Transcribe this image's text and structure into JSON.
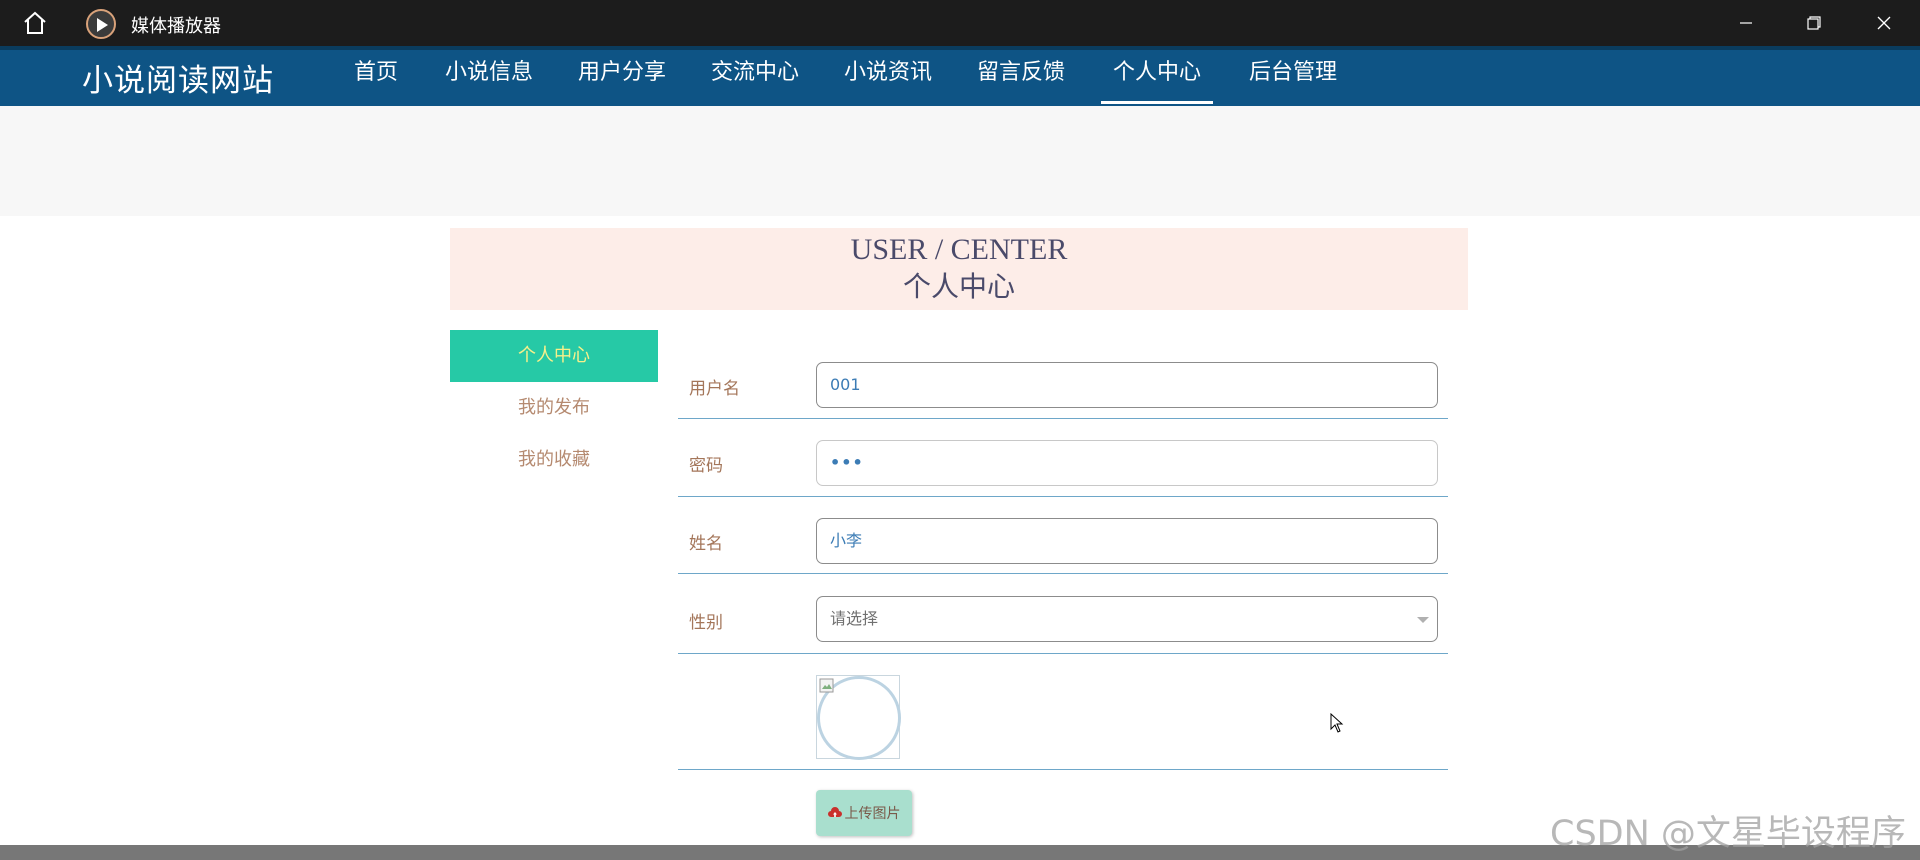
{
  "window": {
    "app_title": "媒体播放器",
    "home_icon": "home-icon",
    "app_icon": "media-player-icon",
    "buttons": [
      "minimize-icon",
      "maximize-icon",
      "close-icon"
    ]
  },
  "site": {
    "brand": "小说阅读网站",
    "nav": [
      {
        "label": "首页"
      },
      {
        "label": "小说信息"
      },
      {
        "label": "用户分享"
      },
      {
        "label": "交流中心"
      },
      {
        "label": "小说资讯"
      },
      {
        "label": "留言反馈"
      },
      {
        "label": "个人中心",
        "active": true
      },
      {
        "label": "后台管理"
      }
    ],
    "colors": {
      "nav_bg": "#0e5485",
      "accent": "#26c9a6",
      "header_bg": "#fdede8"
    }
  },
  "center": {
    "title_en": "USER / CENTER",
    "title_zh": "个人中心"
  },
  "side_menu": [
    {
      "label": "个人中心",
      "active": true
    },
    {
      "label": "我的发布"
    },
    {
      "label": "我的收藏"
    }
  ],
  "form": {
    "username": {
      "label": "用户名",
      "value": "001"
    },
    "password": {
      "label": "密码",
      "value": "•••"
    },
    "name": {
      "label": "姓名",
      "value": "小李"
    },
    "gender": {
      "label": "性别",
      "placeholder": "请选择"
    },
    "upload_label": "上传图片",
    "upload_icon": "cloud-upload-icon"
  },
  "watermark": "CSDN @文星毕设程序"
}
